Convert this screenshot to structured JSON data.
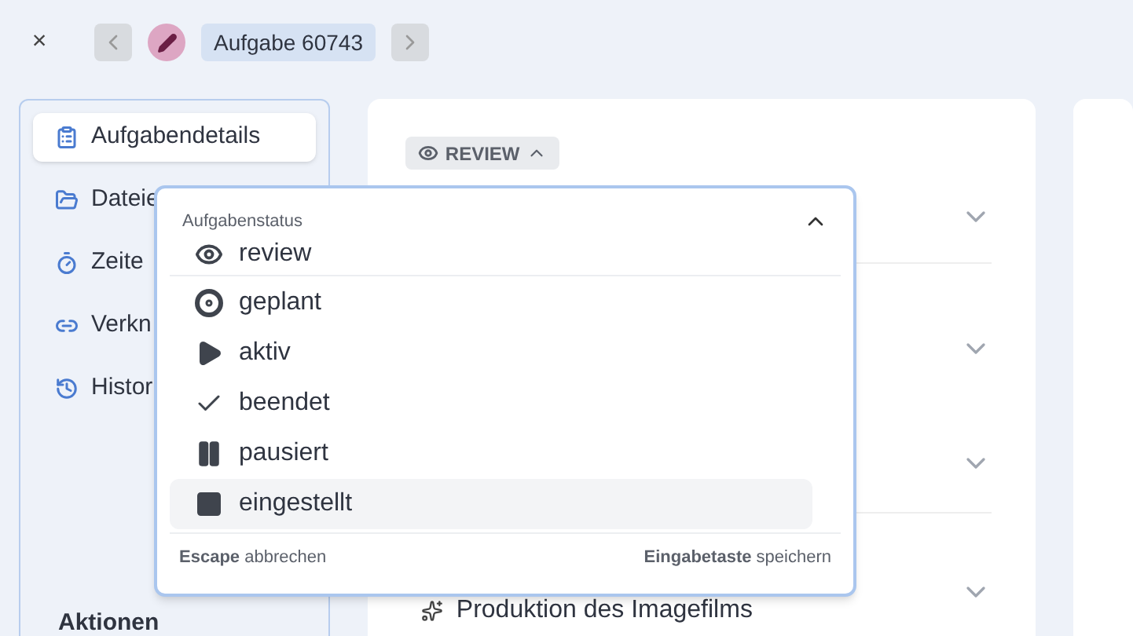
{
  "header": {
    "close": "×",
    "title": "Aufgabe 60743"
  },
  "sidebar": {
    "items": [
      {
        "label": "Aufgabendetails",
        "selected": true
      },
      {
        "label": "Dateie",
        "selected": false
      },
      {
        "label": "Zeite",
        "selected": false
      },
      {
        "label": "Verkn",
        "selected": false
      },
      {
        "label": "Histor",
        "selected": false
      }
    ],
    "section_title": "Aktionen"
  },
  "main": {
    "status_chip": "REVIEW",
    "last_row": "Produktion des Imagefilms"
  },
  "status_menu": {
    "title": "Aufgabenstatus",
    "current": {
      "label": "review",
      "kind": "review"
    },
    "options": [
      {
        "label": "geplant",
        "kind": "planned",
        "selected": false
      },
      {
        "label": "aktiv",
        "kind": "active",
        "selected": false
      },
      {
        "label": "beendet",
        "kind": "done",
        "selected": false
      },
      {
        "label": "pausiert",
        "kind": "paused",
        "selected": false
      },
      {
        "label": "eingestellt",
        "kind": "stopped",
        "selected": true
      }
    ],
    "footer_left": "**Escape** abbrechen",
    "footer_right": "**Eingabetaste** speichern"
  }
}
